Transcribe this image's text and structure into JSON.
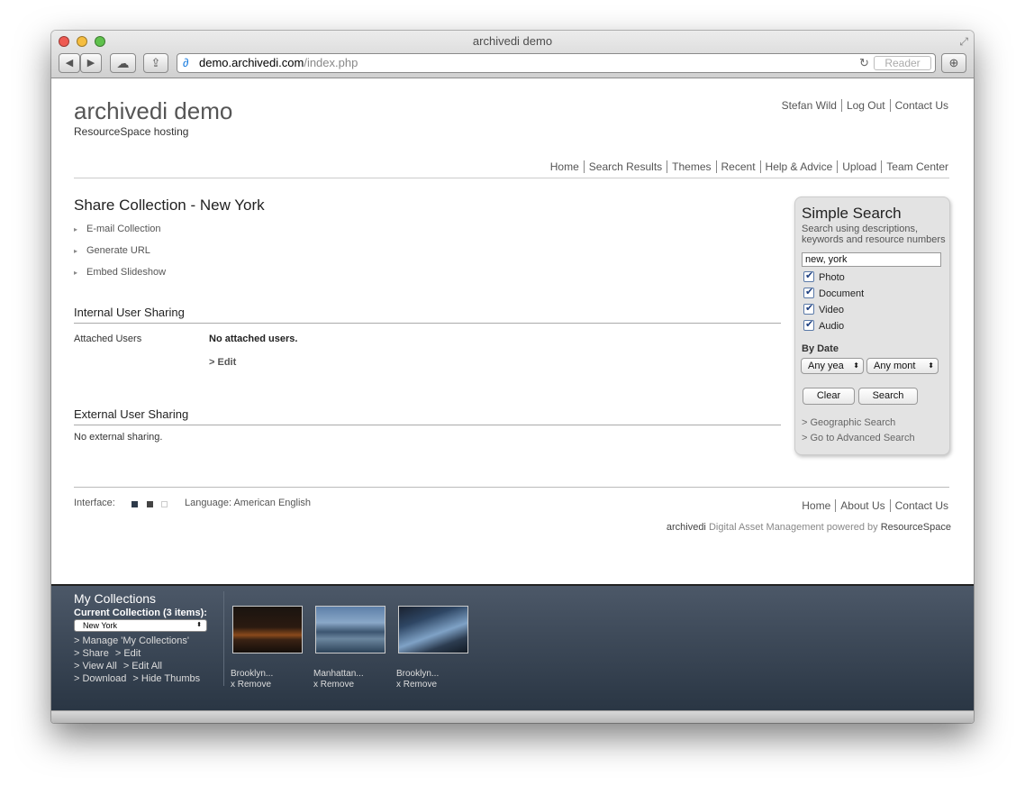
{
  "browser": {
    "window_title": "archivedi demo",
    "url_host": "demo.archivedi.com",
    "url_path": "/index.php",
    "reader_label": "Reader",
    "buttons": {
      "back": "◀",
      "forward": "▶",
      "cloud": "☁",
      "share": "⇪",
      "download": "⊕",
      "reload": "↻"
    }
  },
  "header": {
    "site_title": "archivedi demo",
    "site_subtitle": "ResourceSpace hosting",
    "user_nav": [
      "Stefan Wild",
      "Log Out",
      "Contact Us"
    ],
    "top_nav": [
      "Home",
      "Search Results",
      "Themes",
      "Recent",
      "Help & Advice",
      "Upload",
      "Team Center"
    ]
  },
  "main": {
    "title": "Share Collection - New York",
    "actions": [
      "E-mail Collection",
      "Generate URL",
      "Embed Slideshow"
    ],
    "internal": {
      "heading": "Internal User Sharing",
      "label": "Attached Users",
      "value": "No attached users.",
      "edit": "> Edit"
    },
    "external": {
      "heading": "External User Sharing",
      "value": "No external sharing."
    }
  },
  "search": {
    "title": "Simple Search",
    "description": "Search using descriptions, keywords and resource numbers",
    "query": "new, york",
    "types": [
      {
        "label": "Photo",
        "checked": true
      },
      {
        "label": "Document",
        "checked": true
      },
      {
        "label": "Video",
        "checked": true
      },
      {
        "label": "Audio",
        "checked": true
      }
    ],
    "by_date": "By Date",
    "year_select": "Any yea",
    "month_select": "Any mont",
    "clear": "Clear",
    "search": "Search",
    "links": [
      "> Geographic Search",
      "> Go to Advanced Search"
    ]
  },
  "footer": {
    "interface_label": "Interface:",
    "interface_colors": [
      "#2d3a4a",
      "#444444",
      "#ffffff"
    ],
    "language": "Language: American English",
    "nav": [
      "Home",
      "About Us",
      "Contact Us"
    ],
    "powered_brand": "archivedi",
    "powered_text": " Digital Asset Management powered by ",
    "powered_product": "ResourceSpace"
  },
  "collections": {
    "title": "My Collections",
    "current": "Current Collection (3 items):",
    "selected": "New York",
    "links": [
      [
        "> Manage 'My Collections'"
      ],
      [
        "> Share",
        "> Edit"
      ],
      [
        "> View All",
        "> Edit All"
      ],
      [
        "> Download",
        "> Hide Thumbs"
      ]
    ],
    "items": [
      {
        "title": "Brooklyn...",
        "remove": "x Remove"
      },
      {
        "title": "Manhattan...",
        "remove": "x Remove"
      },
      {
        "title": "Brooklyn...",
        "remove": "x Remove"
      }
    ]
  },
  "colors": {
    "accent": "#1d3f80",
    "collection_bar": "#3b4757"
  }
}
